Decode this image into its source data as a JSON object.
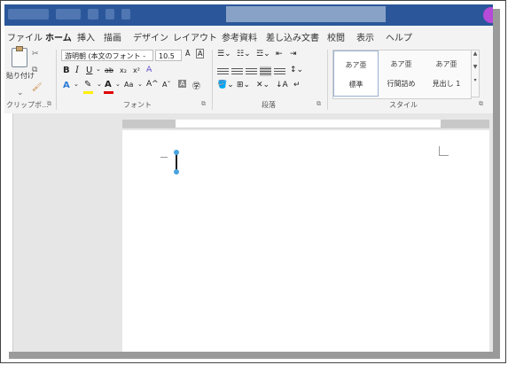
{
  "ribbon_tabs": [
    "ファイル",
    "ホーム",
    "挿入",
    "描画",
    "デザイン",
    "レイアウト",
    "参考資料",
    "差し込み文書",
    "校閲",
    "表示",
    "ヘルプ"
  ],
  "active_tab": "ホーム",
  "clipboard": {
    "paste_label": "貼り付け",
    "group_label": "クリップボ…"
  },
  "font": {
    "font_name": "游明朝 (本文のフォント -",
    "font_size": "10.5",
    "group_label": "フォント"
  },
  "paragraph": {
    "group_label": "段落"
  },
  "styles": {
    "items": [
      {
        "sample": "あア亜",
        "name": "標準"
      },
      {
        "sample": "あア亜",
        "name": "行間詰め"
      },
      {
        "sample": "あア亜",
        "name": "見出し 1"
      }
    ],
    "group_label": "スタイル"
  },
  "colors": {
    "accent": "#2b579a",
    "highlight_yellow": "#ffef00",
    "font_red": "#e00000",
    "cursor_handle": "#4aa3df",
    "titlebar": "#2b579a"
  }
}
